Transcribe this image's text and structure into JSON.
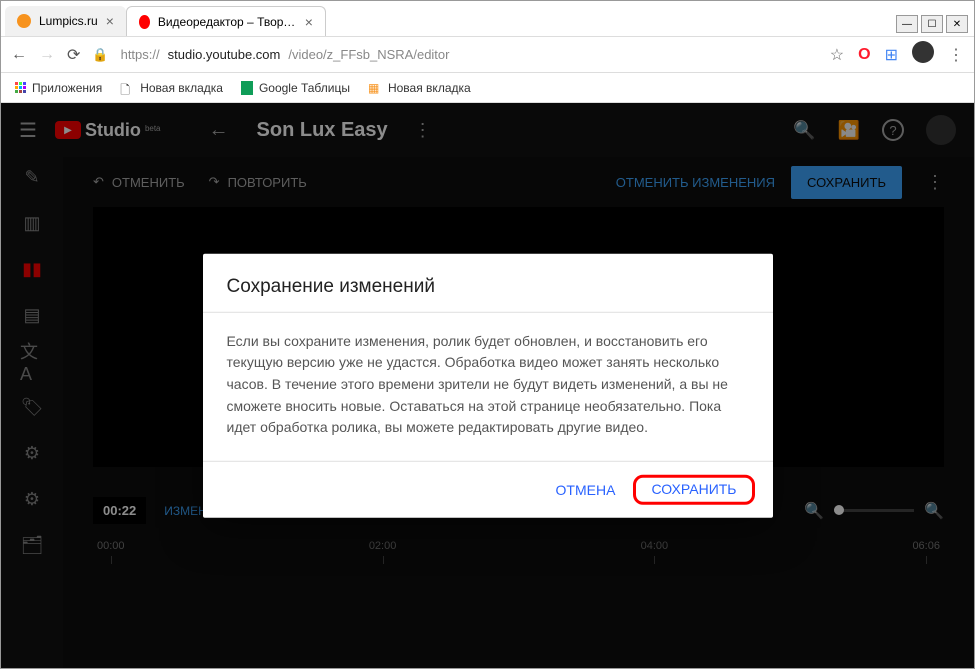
{
  "browser": {
    "tabs": [
      {
        "title": "Lumpics.ru",
        "favicon_bg": "#f7931e"
      },
      {
        "title": "Видеоредактор – Творческая ст",
        "favicon_bg": "#ff0000"
      }
    ],
    "window_buttons": {
      "min": "—",
      "max": "☐",
      "close": "✕"
    },
    "url_scheme": "https://",
    "url_host": "studio.youtube.com",
    "url_path": "/video/z_FFsb_NSRA/editor",
    "address_icons": {
      "star": "☆",
      "opera": "O",
      "ext": "≡",
      "menu": "⋮"
    },
    "bookmarks": {
      "apps_label": "Приложения",
      "items": [
        "Новая вкладка",
        "Google Таблицы",
        "Новая вкладка"
      ]
    }
  },
  "studio": {
    "brand": "Studio",
    "beta": "beta",
    "video_title": "Son Lux Easy",
    "header_icons": {
      "search": "🔍",
      "create": "🎦",
      "help": "?"
    },
    "sidebar_items": [
      "pencil",
      "analytics",
      "editor",
      "comments",
      "translate",
      "copyright",
      "monetize",
      "settings",
      "library"
    ],
    "toolbar": {
      "undo": "ОТМЕНИТЬ",
      "redo": "ПОВТОРИТЬ",
      "discard": "ОТМЕНИТЬ ИЗМЕНЕНИЯ",
      "save": "СОХРАНИТЬ"
    },
    "timeline": {
      "timecode": "00:22",
      "trim_label": "ИЗМЕНИТЬ ГРАНИЦУ ОБРЕЗКИ",
      "ticks": [
        "00:00",
        "02:00",
        "04:00",
        "06:06"
      ]
    }
  },
  "dialog": {
    "title": "Сохранение изменений",
    "body": "Если вы сохраните изменения, ролик будет обновлен, и восстановить его текущую версию уже не удастся. Обработка видео может занять несколько часов. В течение этого времени зрители не будут видеть изменений, а вы не сможете вносить новые. Оставаться на этой странице необязательно. Пока идет обработка ролика, вы можете редактировать другие видео.",
    "cancel": "ОТМЕНА",
    "save": "СОХРАНИТЬ"
  }
}
